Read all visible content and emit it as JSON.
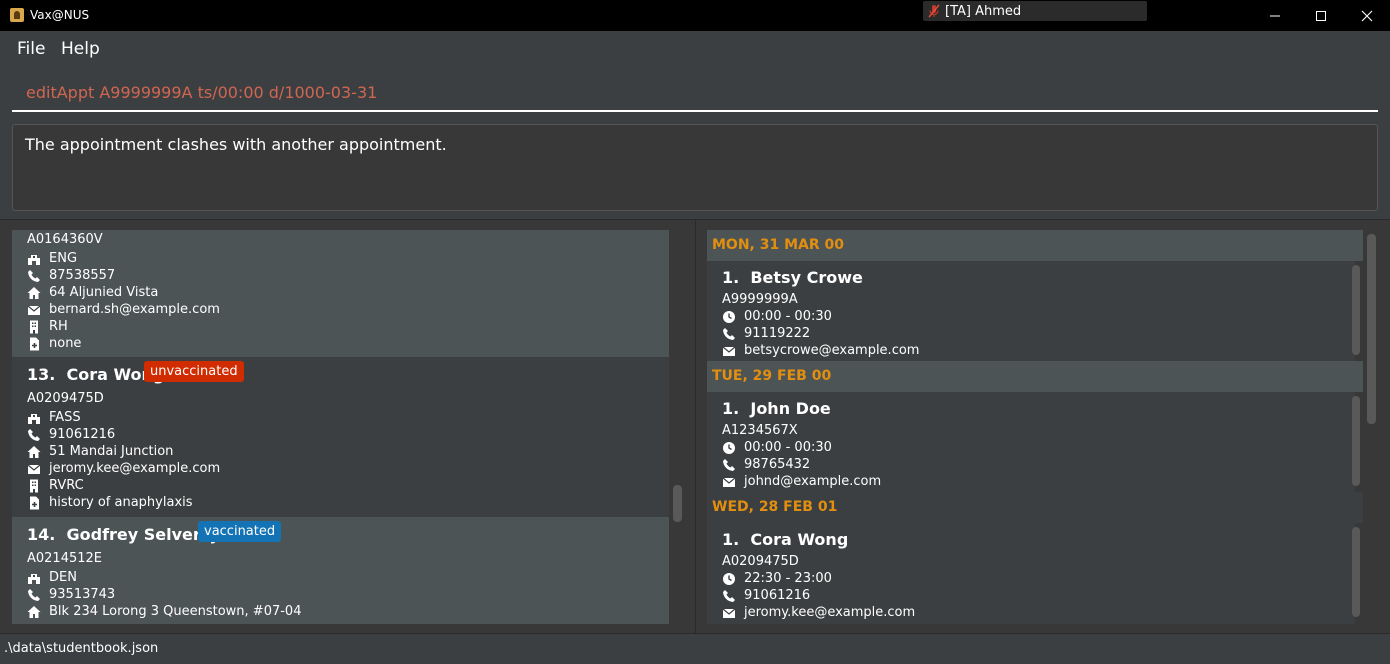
{
  "window": {
    "title": "Vax@NUS",
    "meeting_label": "[TA] Ahmed"
  },
  "menu": {
    "file": "File",
    "help": "Help"
  },
  "command": {
    "value": "editAppt A9999999A ts/00:00 d/1000-03-31"
  },
  "result": {
    "message": "The appointment clashes with another appointment."
  },
  "students": {
    "partial": {
      "id": "A0164360V",
      "faculty": "ENG",
      "phone": "87538557",
      "address": "64 Aljunied Vista",
      "email": "bernard.sh@example.com",
      "residence": "RH",
      "medical": "none"
    },
    "cora": {
      "index": "13.",
      "name": "Cora Wong",
      "status": "unvaccinated",
      "id": "A0209475D",
      "faculty": "FASS",
      "phone": "91061216",
      "address": "51 Mandai Junction",
      "email": "jeromy.kee@example.com",
      "residence": "RVRC",
      "medical": "history of anaphylaxis"
    },
    "godfrey": {
      "index": "14.",
      "name": "Godfrey Selverajah",
      "status": "vaccinated",
      "id": "A0214512E",
      "faculty": "DEN",
      "phone": "93513743",
      "address": "Blk 234 Lorong 3 Queenstown, #07-04"
    }
  },
  "appointments": [
    {
      "day": "MON, 31 MAR 00",
      "index": "1.",
      "name": "Betsy Crowe",
      "id": "A9999999A",
      "time": "00:00 - 00:30",
      "phone": "91119222",
      "email": "betsycrowe@example.com"
    },
    {
      "day": "TUE, 29 FEB 00",
      "index": "1.",
      "name": "John Doe",
      "id": "A1234567X",
      "time": "00:00 - 00:30",
      "phone": "98765432",
      "email": "johnd@example.com"
    },
    {
      "day": "WED, 28 FEB 01",
      "index": "1.",
      "name": "Cora Wong",
      "id": "A0209475D",
      "time": "22:30 - 23:00",
      "phone": "91061216",
      "email": "jeromy.kee@example.com"
    }
  ],
  "status": {
    "path": ".\\data\\studentbook.json"
  },
  "colors": {
    "background": "#3c3f41",
    "command_text": "#d06651",
    "day_header": "#e28f0f",
    "unvaccinated": "#d12b00",
    "vaccinated": "#1373b5"
  }
}
